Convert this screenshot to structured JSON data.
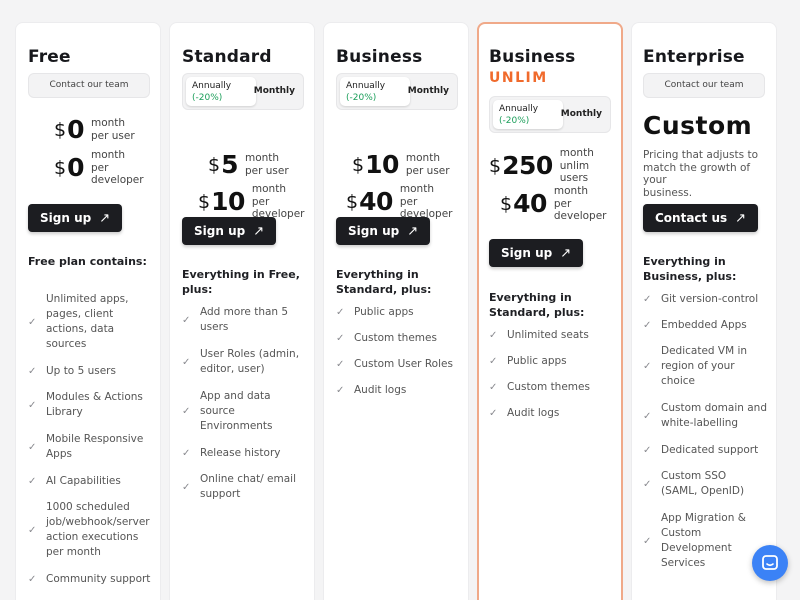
{
  "plans": {
    "free": {
      "title": "Free",
      "contact_label": "Contact our team",
      "prices": [
        {
          "currency": "$",
          "amount": "0",
          "unit_line1": "month",
          "unit_line2": "per user",
          "unit_line3": ""
        },
        {
          "currency": "$",
          "amount": "0",
          "unit_line1": "month",
          "unit_line2": "per",
          "unit_line3": "developer"
        }
      ],
      "cta_label": "Sign up",
      "features_heading_line1": "Free plan contains:",
      "features": [
        [
          "Unlimited apps,",
          "pages, client",
          "actions, data",
          "sources"
        ],
        [
          "Up to 5 users"
        ],
        [
          "Modules & Actions",
          "Library"
        ],
        [
          "Mobile Responsive",
          "Apps"
        ],
        [
          "AI Capabilities"
        ],
        [
          "1000 scheduled",
          "job/webhook/server",
          "action executions",
          "per month"
        ],
        [
          "Community support"
        ]
      ]
    },
    "standard": {
      "title": "Standard",
      "toggle": {
        "annual": "Annually",
        "discount": "(-20%)",
        "monthly": "Monthly"
      },
      "prices": [
        {
          "currency": "$",
          "amount": "5",
          "unit_line1": "month",
          "unit_line2": "per user",
          "unit_line3": ""
        },
        {
          "currency": "$",
          "amount": "10",
          "unit_line1": "month",
          "unit_line2": "per",
          "unit_line3": "developer"
        }
      ],
      "cta_label": "Sign up",
      "features_heading_line1": "Everything in Free,",
      "features_heading_line2": "plus:",
      "features": [
        [
          "Add more than 5",
          "users"
        ],
        [
          "User Roles (admin,",
          "editor, user)"
        ],
        [
          "App and data",
          "source",
          "Environments"
        ],
        [
          "Release history"
        ],
        [
          "Online chat/ email",
          "support"
        ]
      ]
    },
    "business": {
      "title": "Business",
      "toggle": {
        "annual": "Annually",
        "discount": "(-20%)",
        "monthly": "Monthly"
      },
      "prices": [
        {
          "currency": "$",
          "amount": "10",
          "unit_line1": "month",
          "unit_line2": "per user",
          "unit_line3": ""
        },
        {
          "currency": "$",
          "amount": "40",
          "unit_line1": "month",
          "unit_line2": "per",
          "unit_line3": "developer"
        }
      ],
      "cta_label": "Sign up",
      "features_heading_line1": "Everything in",
      "features_heading_line2": "Standard, plus:",
      "features": [
        [
          "Public apps"
        ],
        [
          "Custom themes"
        ],
        [
          "Custom User Roles"
        ],
        [
          "Audit logs"
        ]
      ]
    },
    "business_unlim": {
      "title": "Business",
      "subtitle": "UNLIM",
      "toggle": {
        "annual": "Annually",
        "discount": "(-20%)",
        "monthly": "Monthly"
      },
      "prices": [
        {
          "currency": "$",
          "amount": "250",
          "unit_line1": "month",
          "unit_line2": "unlim",
          "unit_line3": "users"
        },
        {
          "currency": "$",
          "amount": "40",
          "unit_line1": "month",
          "unit_line2": "per",
          "unit_line3": "developer"
        }
      ],
      "cta_label": "Sign up",
      "features_heading_line1": "Everything in",
      "features_heading_line2": "Standard, plus:",
      "features": [
        [
          "Unlimited seats"
        ],
        [
          "Public apps"
        ],
        [
          "Custom themes"
        ],
        [
          "Audit logs"
        ]
      ]
    },
    "enterprise": {
      "title": "Enterprise",
      "contact_label": "Contact our team",
      "custom_label": "Custom",
      "description": [
        "Pricing that adjusts to",
        "match the growth of your",
        "business."
      ],
      "cta_label": "Contact us",
      "features_heading_line1": "Everything in",
      "features_heading_line2": "Business, plus:",
      "features": [
        [
          "Git version-control"
        ],
        [
          "Embedded Apps"
        ],
        [
          "Dedicated VM in",
          "region of your",
          "choice"
        ],
        [
          "Custom domain and",
          "white-labelling"
        ],
        [
          "Dedicated support"
        ],
        [
          "Custom SSO",
          "(SAML, OpenID)"
        ],
        [
          "App Migration &",
          "Custom",
          "Development",
          "Services"
        ]
      ]
    }
  },
  "colors": {
    "accent": "#f06a2c",
    "highlight_border": "#f0a989",
    "discount": "#1b9e5a",
    "chat": "#3b82f6"
  },
  "chat_icon": "chat-icon"
}
